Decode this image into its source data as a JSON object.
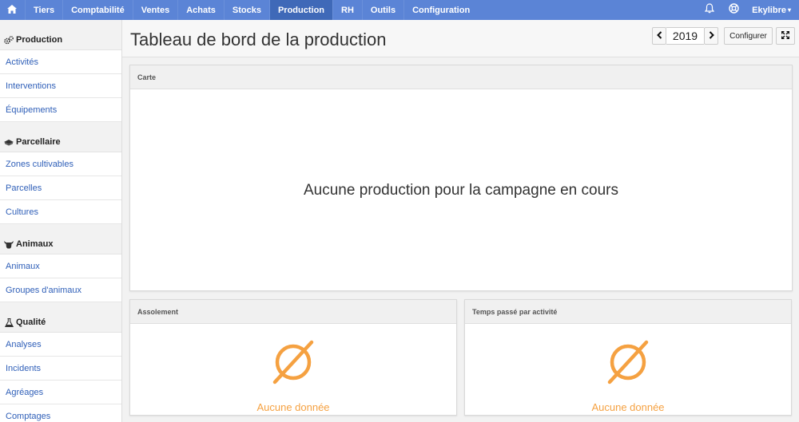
{
  "topbar": {
    "home_icon": "home-icon",
    "items": [
      "Tiers",
      "Comptabilité",
      "Ventes",
      "Achats",
      "Stocks",
      "Production",
      "RH",
      "Outils",
      "Configuration"
    ],
    "active": "Production",
    "bell_icon": "bell-icon",
    "help_icon": "lifebuoy-icon",
    "user": "Ekylibre",
    "colors": {
      "bar": "#5b84d6",
      "active": "#3f69b8"
    }
  },
  "sidebar": {
    "sections": [
      {
        "title": "Production",
        "icon": "gears-icon",
        "links": [
          "Activités",
          "Interventions",
          "Équipements"
        ]
      },
      {
        "title": "Parcellaire",
        "icon": "land-icon",
        "links": [
          "Zones cultivables",
          "Parcelles",
          "Cultures"
        ]
      },
      {
        "title": "Animaux",
        "icon": "cow-icon",
        "links": [
          "Animaux",
          "Groupes d'animaux"
        ]
      },
      {
        "title": "Qualité",
        "icon": "flask-icon",
        "links": [
          "Analyses",
          "Incidents",
          "Agréages",
          "Comptages"
        ]
      }
    ]
  },
  "header": {
    "title": "Tableau de bord de la production",
    "year": "2019",
    "prev_icon": "chevron-left-icon",
    "next_icon": "chevron-right-icon",
    "configure_label": "Configurer",
    "fullscreen_icon": "expand-icon"
  },
  "panels": {
    "carte": {
      "title": "Carte",
      "message": "Aucune production pour la campagne en cours"
    },
    "assolement": {
      "title": "Assolement",
      "empty_label": "Aucune donnée",
      "icon": "empty-set-icon"
    },
    "temps": {
      "title": "Temps passé par activité",
      "empty_label": "Aucune donnée",
      "icon": "empty-set-icon"
    },
    "accent_color": "#f5a141"
  }
}
